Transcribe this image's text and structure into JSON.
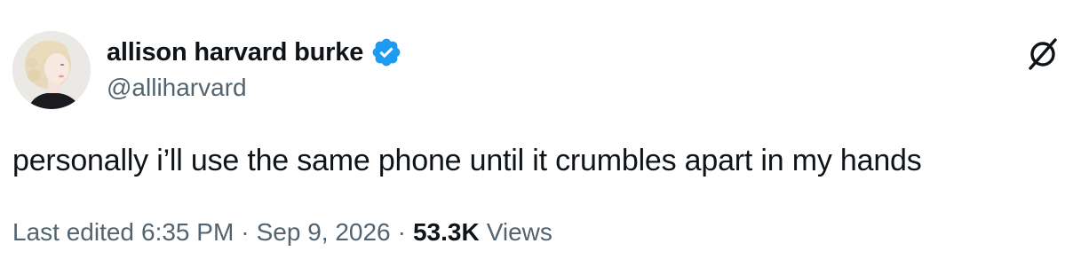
{
  "author": {
    "display_name": "allison harvard burke",
    "handle": "@alliharvard",
    "verified": true,
    "verified_color": "#1d9bf0"
  },
  "icons": {
    "avatar": "profile-photo",
    "verified": "verified-badge-icon",
    "top_right": "grok-icon"
  },
  "tweet": {
    "text": "personally i’ll use the same phone until it crumbles apart in my hands"
  },
  "meta": {
    "edited_label": "Last edited",
    "time": "6:35 PM",
    "separator": "·",
    "date": "Sep 9, 2026",
    "views_count": "53.3K",
    "views_label": "Views"
  },
  "colors": {
    "text_primary": "#0f1419",
    "text_secondary": "#536471",
    "background": "#ffffff"
  }
}
